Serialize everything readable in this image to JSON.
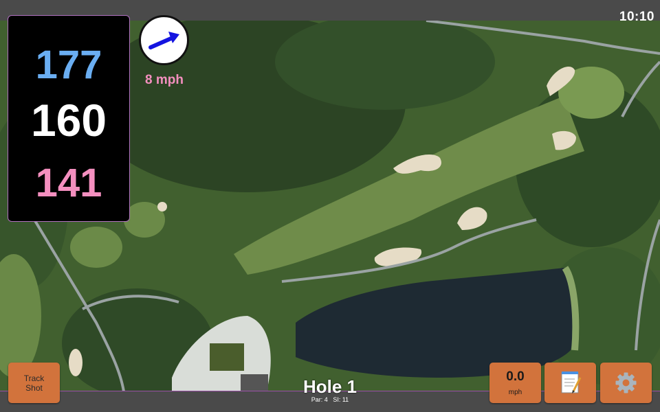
{
  "status": {
    "time": "10:10"
  },
  "yardages": {
    "back": "177",
    "middle": "160",
    "front": "141"
  },
  "wind": {
    "speed": "8 mph",
    "direction_icon": "arrow-icon"
  },
  "hole": {
    "title": "Hole 1",
    "par_label": "Par: 4",
    "si_label": "SI: 11"
  },
  "buttons": {
    "track_shot": "Track\nShot",
    "speed_value": "0.0",
    "speed_unit": "mph",
    "notes_icon": "notepad-icon",
    "settings_icon": "gear-icon"
  },
  "colors": {
    "back": "#6aaef2",
    "middle": "#ffffff",
    "front": "#f48fbf",
    "button": "#d2733c",
    "accent_line": "#9b4fa8"
  }
}
